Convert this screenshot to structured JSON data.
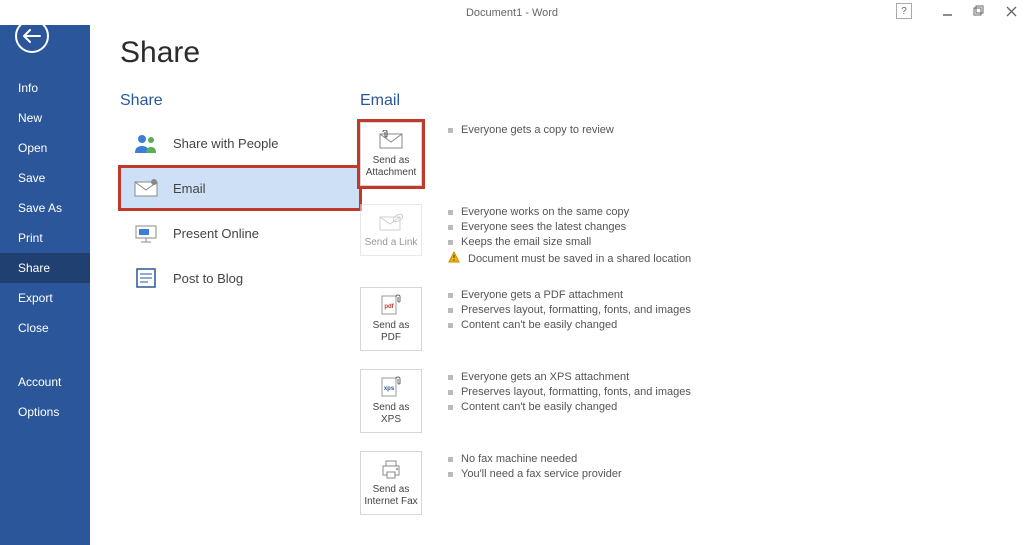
{
  "titlebar": {
    "title": "Document1 - Word"
  },
  "sidebar": {
    "items": [
      {
        "label": "Info"
      },
      {
        "label": "New"
      },
      {
        "label": "Open"
      },
      {
        "label": "Save"
      },
      {
        "label": "Save As"
      },
      {
        "label": "Print"
      },
      {
        "label": "Share"
      },
      {
        "label": "Export"
      },
      {
        "label": "Close"
      }
    ],
    "footer_items": [
      {
        "label": "Account"
      },
      {
        "label": "Options"
      }
    ]
  },
  "page": {
    "title": "Share",
    "share_heading": "Share",
    "email_heading": "Email",
    "share_options": [
      {
        "label": "Share with People"
      },
      {
        "label": "Email"
      },
      {
        "label": "Present Online"
      },
      {
        "label": "Post to Blog"
      }
    ],
    "email_options": [
      {
        "label": "Send as Attachment",
        "lines": [
          {
            "text": "Everyone gets a copy to review"
          }
        ]
      },
      {
        "label": "Send a Link",
        "lines": [
          {
            "text": "Everyone works on the same copy"
          },
          {
            "text": "Everyone sees the latest changes"
          },
          {
            "text": "Keeps the email size small"
          },
          {
            "text": "Document must be saved in a shared location",
            "warn": true
          }
        ]
      },
      {
        "label": "Send as PDF",
        "lines": [
          {
            "text": "Everyone gets a PDF attachment"
          },
          {
            "text": "Preserves layout, formatting, fonts, and images"
          },
          {
            "text": "Content can't be easily changed"
          }
        ]
      },
      {
        "label": "Send as XPS",
        "lines": [
          {
            "text": "Everyone gets an XPS attachment"
          },
          {
            "text": "Preserves layout, formatting, fonts, and images"
          },
          {
            "text": "Content can't be easily changed"
          }
        ]
      },
      {
        "label": "Send as Internet Fax",
        "lines": [
          {
            "text": "No fax machine needed"
          },
          {
            "text": "You'll need a fax service provider"
          }
        ]
      }
    ]
  }
}
